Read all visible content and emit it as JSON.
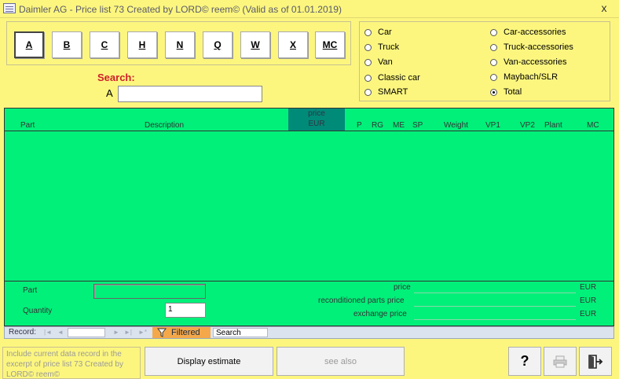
{
  "window": {
    "title": "Daimler AG - Price list 73  Created by LORD© reem© (Valid as of 01.01.2019)",
    "close_glyph": "x"
  },
  "letters": [
    {
      "label": "A",
      "active": true
    },
    {
      "label": "B"
    },
    {
      "label": "C"
    },
    {
      "label": "H"
    },
    {
      "label": "N"
    },
    {
      "label": "Q"
    },
    {
      "label": "W"
    },
    {
      "label": "X"
    },
    {
      "label": "MC"
    }
  ],
  "search": {
    "label": "Search:",
    "prefix": "A",
    "value": ""
  },
  "options": [
    {
      "label": "Car",
      "checked": false
    },
    {
      "label": "Truck",
      "checked": false
    },
    {
      "label": "Van",
      "checked": false
    },
    {
      "label": "Classic car",
      "checked": false
    },
    {
      "label": "SMART",
      "checked": false
    },
    {
      "label": "Car-accessories",
      "checked": false
    },
    {
      "label": "Truck-accessories",
      "checked": false
    },
    {
      "label": "Van-accessories",
      "checked": false
    },
    {
      "label": "Maybach/SLR",
      "checked": false
    },
    {
      "label": "Total",
      "checked": true
    }
  ],
  "grid": {
    "columns": {
      "part": "Part",
      "description": "Description",
      "price_line1": "price",
      "price_line2": "EUR",
      "p": "P",
      "rg": "RG",
      "me": "ME",
      "sp": "SP",
      "weight": "Weight",
      "vp1": "VP1",
      "vp2": "VP2",
      "plant": "Plant",
      "mc": "MC"
    },
    "rows": []
  },
  "footer": {
    "part_label": "Part",
    "part_value": "",
    "quantity_label": "Quantity",
    "quantity_value": "1",
    "price_label": "price",
    "reconditioned_label": "reconditioned parts price",
    "exchange_label": "exchange price",
    "currency": "EUR"
  },
  "navigation": {
    "record_label": "Record:",
    "first": "|◄",
    "prev": "◄",
    "next": "►",
    "last": "►|",
    "new": "►*",
    "filtered_label": "Filtered",
    "search_label": "Search"
  },
  "bottom": {
    "include_text": "Include current data record in the excerpt of price list 73  Created by LORD© reem©",
    "display_estimate": "Display estimate",
    "see_also": "see also",
    "help_glyph": "?",
    "print_glyph": "print",
    "exit_glyph": "exit"
  },
  "colors": {
    "background": "#fcf67f",
    "grid": "#00f07a",
    "price_header": "#008a78",
    "search_label": "#d0202a",
    "filtered": "#f4a84a"
  }
}
